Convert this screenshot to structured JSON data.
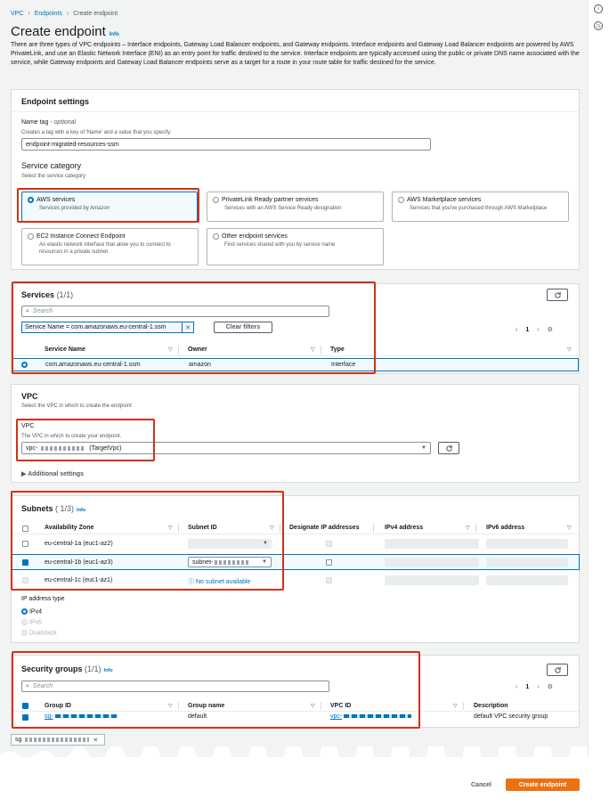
{
  "breadcrumb": {
    "root": "VPC",
    "parent": "Endpoints",
    "current": "Create endpoint"
  },
  "page": {
    "title": "Create endpoint",
    "info": "Info",
    "intro": "There are three types of VPC endpoints – Interface endpoints, Gateway Load Balancer endpoints, and Gateway endpoints. Interface endpoints and Gateway Load Balancer endpoints are powered by AWS PrivateLink, and use an Elastic Network Interface (ENI) as an entry point for traffic destined to the service. Interface endpoints are typically accessed using the public or private DNS name associated with the service, while Gateway endpoints and Gateway Load Balancer endpoints serve as a target for a route in your route table for traffic destined for the service."
  },
  "settings": {
    "title": "Endpoint settings",
    "name_label": "Name tag",
    "name_optional": "- optional",
    "name_desc": "Creates a tag with a key of 'Name' and a value that you specify.",
    "name_value": "endpoint-migrated-resources-ssm",
    "category_title": "Service category",
    "category_desc": "Select the service category",
    "tiles": [
      {
        "title": "AWS services",
        "desc": "Services provided by Amazon"
      },
      {
        "title": "PrivateLink Ready partner services",
        "desc": "Services with an AWS Service Ready designation"
      },
      {
        "title": "AWS Marketplace services",
        "desc": "Services that you've purchased through AWS Marketplace"
      },
      {
        "title": "EC2 Instance Connect Endpoint",
        "desc": "An elastic network interface that allow you to connect to resources in a private subnet"
      },
      {
        "title": "Other endpoint services",
        "desc": "Find services shared with you by service name"
      }
    ]
  },
  "services": {
    "title": "Services",
    "count": "(1/1)",
    "search_placeholder": "Search",
    "filter_tag": "Service Name = com.amazonaws.eu-central-1.ssm",
    "clear_filters": "Clear filters",
    "page": "1",
    "columns": [
      "Service Name",
      "Owner",
      "Type"
    ],
    "row": {
      "name": "com.amazonaws.eu-central-1.ssm",
      "owner": "amazon",
      "type": "Interface"
    }
  },
  "vpc": {
    "title": "VPC",
    "desc": "Select the VPC in which to create the endpoint",
    "label": "VPC",
    "sub": "The VPC in which to create your endpoint.",
    "value_prefix": "vpc-",
    "value_suffix": "(TargetVpc)",
    "additional": "Additional settings"
  },
  "subnets": {
    "title": "Subnets",
    "count": "( 1/3)",
    "info": "Info",
    "columns": [
      "Availability Zone",
      "Subnet ID",
      "Designate IP addresses",
      "IPv4 address",
      "IPv6 address"
    ],
    "rows": [
      {
        "az": "eu-central-1a (euc1-az2)",
        "subnet": ""
      },
      {
        "az": "eu-central-1b (euc1-az3)",
        "subnet": "subnet-"
      },
      {
        "az": "eu-central-1c (euc1-az1)",
        "subnet": "No subnet available"
      }
    ],
    "ip_type_label": "IP address type",
    "ip_types": [
      "IPv4",
      "IPv6",
      "Dualstack"
    ]
  },
  "security": {
    "title": "Security groups",
    "count": "(1/1)",
    "info": "Info",
    "search_placeholder": "Search",
    "page": "1",
    "columns": [
      "Group ID",
      "Group name",
      "VPC ID",
      "Description"
    ],
    "row": {
      "group_id": "sg-",
      "group_name": "default",
      "vpc_id": "vpc-",
      "description": "default VPC security group"
    },
    "token": "sg"
  },
  "footer": {
    "cancel": "Cancel",
    "create": "Create endpoint"
  },
  "colors": {
    "accent": "#0073bb",
    "primary": "#ec7211",
    "highlight": "#d13212"
  }
}
